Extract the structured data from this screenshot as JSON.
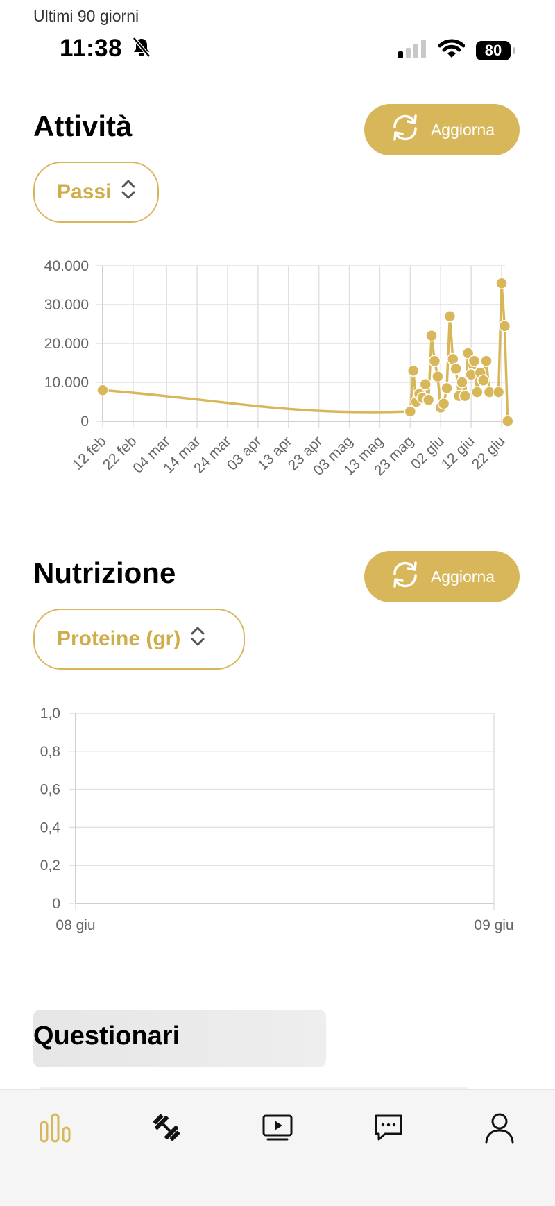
{
  "status_bar": {
    "period_label": "Ultimi 90 giorni",
    "time": "11:38",
    "battery": "80"
  },
  "activity": {
    "title": "Attività",
    "refresh_label": "Aggiorna",
    "selected_metric": "Passi",
    "chart_data": {
      "type": "line",
      "y_ticks": [
        "40.000",
        "30.000",
        "20.000",
        "10.000",
        "0"
      ],
      "ylim": [
        0,
        40000
      ],
      "x_ticks": [
        "12 feb",
        "22 feb",
        "04 mar",
        "14 mar",
        "24 mar",
        "03 apr",
        "13 apr",
        "23 apr",
        "03 mag",
        "13 mag",
        "23 mag",
        "02 giu",
        "12 giu",
        "22 giu"
      ],
      "grid": true,
      "series": [
        {
          "values": [
            {
              "x": "12 feb",
              "y": 8000
            },
            {
              "x": "23 mag",
              "y": 2500
            },
            {
              "x": "24 mag",
              "y": 13000
            },
            {
              "x": "25 mag",
              "y": 5000
            },
            {
              "x": "26 mag",
              "y": 7000
            },
            {
              "x": "27 mag",
              "y": 6000
            },
            {
              "x": "28 mag",
              "y": 9500
            },
            {
              "x": "29 mag",
              "y": 5500
            },
            {
              "x": "30 mag",
              "y": 22000
            },
            {
              "x": "31 mag",
              "y": 15500
            },
            {
              "x": "01 giu",
              "y": 11500
            },
            {
              "x": "02 giu",
              "y": 3500
            },
            {
              "x": "03 giu",
              "y": 4500
            },
            {
              "x": "04 giu",
              "y": 8500
            },
            {
              "x": "05 giu",
              "y": 27000
            },
            {
              "x": "06 giu",
              "y": 16000
            },
            {
              "x": "07 giu",
              "y": 13500
            },
            {
              "x": "08 giu",
              "y": 6500
            },
            {
              "x": "09 giu",
              "y": 10000
            },
            {
              "x": "10 giu",
              "y": 6500
            },
            {
              "x": "11 giu",
              "y": 17500
            },
            {
              "x": "12 giu",
              "y": 12000
            },
            {
              "x": "13 giu",
              "y": 15500
            },
            {
              "x": "14 giu",
              "y": 7500
            },
            {
              "x": "15 giu",
              "y": 12500
            },
            {
              "x": "16 giu",
              "y": 10500
            },
            {
              "x": "17 giu",
              "y": 15500
            },
            {
              "x": "18 giu",
              "y": 7500
            },
            {
              "x": "21 giu",
              "y": 7500
            },
            {
              "x": "22 giu",
              "y": 35500
            },
            {
              "x": "23 giu",
              "y": 24500
            },
            {
              "x": "24 giu",
              "y": 0
            }
          ]
        }
      ]
    }
  },
  "nutrition": {
    "title": "Nutrizione",
    "refresh_label": "Aggiorna",
    "selected_metric": "Proteine (gr)",
    "chart_data": {
      "type": "line",
      "y_ticks": [
        "1,0",
        "0,8",
        "0,6",
        "0,4",
        "0,2",
        "0"
      ],
      "ylim": [
        0,
        1
      ],
      "x_ticks": [
        "08 giu",
        "09 giu"
      ],
      "grid": true,
      "series": []
    }
  },
  "questionnaires": {
    "title": "Questionari"
  },
  "tabbar": {
    "items": [
      {
        "icon": "stats-bars-icon",
        "active": true
      },
      {
        "icon": "dumbbell-icon",
        "active": false
      },
      {
        "icon": "video-player-icon",
        "active": false
      },
      {
        "icon": "chat-bubble-icon",
        "active": false
      },
      {
        "icon": "user-profile-icon",
        "active": false
      }
    ]
  },
  "colors": {
    "accent": "#d8b75b",
    "accent_text": "#d0ad4b",
    "grid": "#e0e0e0"
  }
}
